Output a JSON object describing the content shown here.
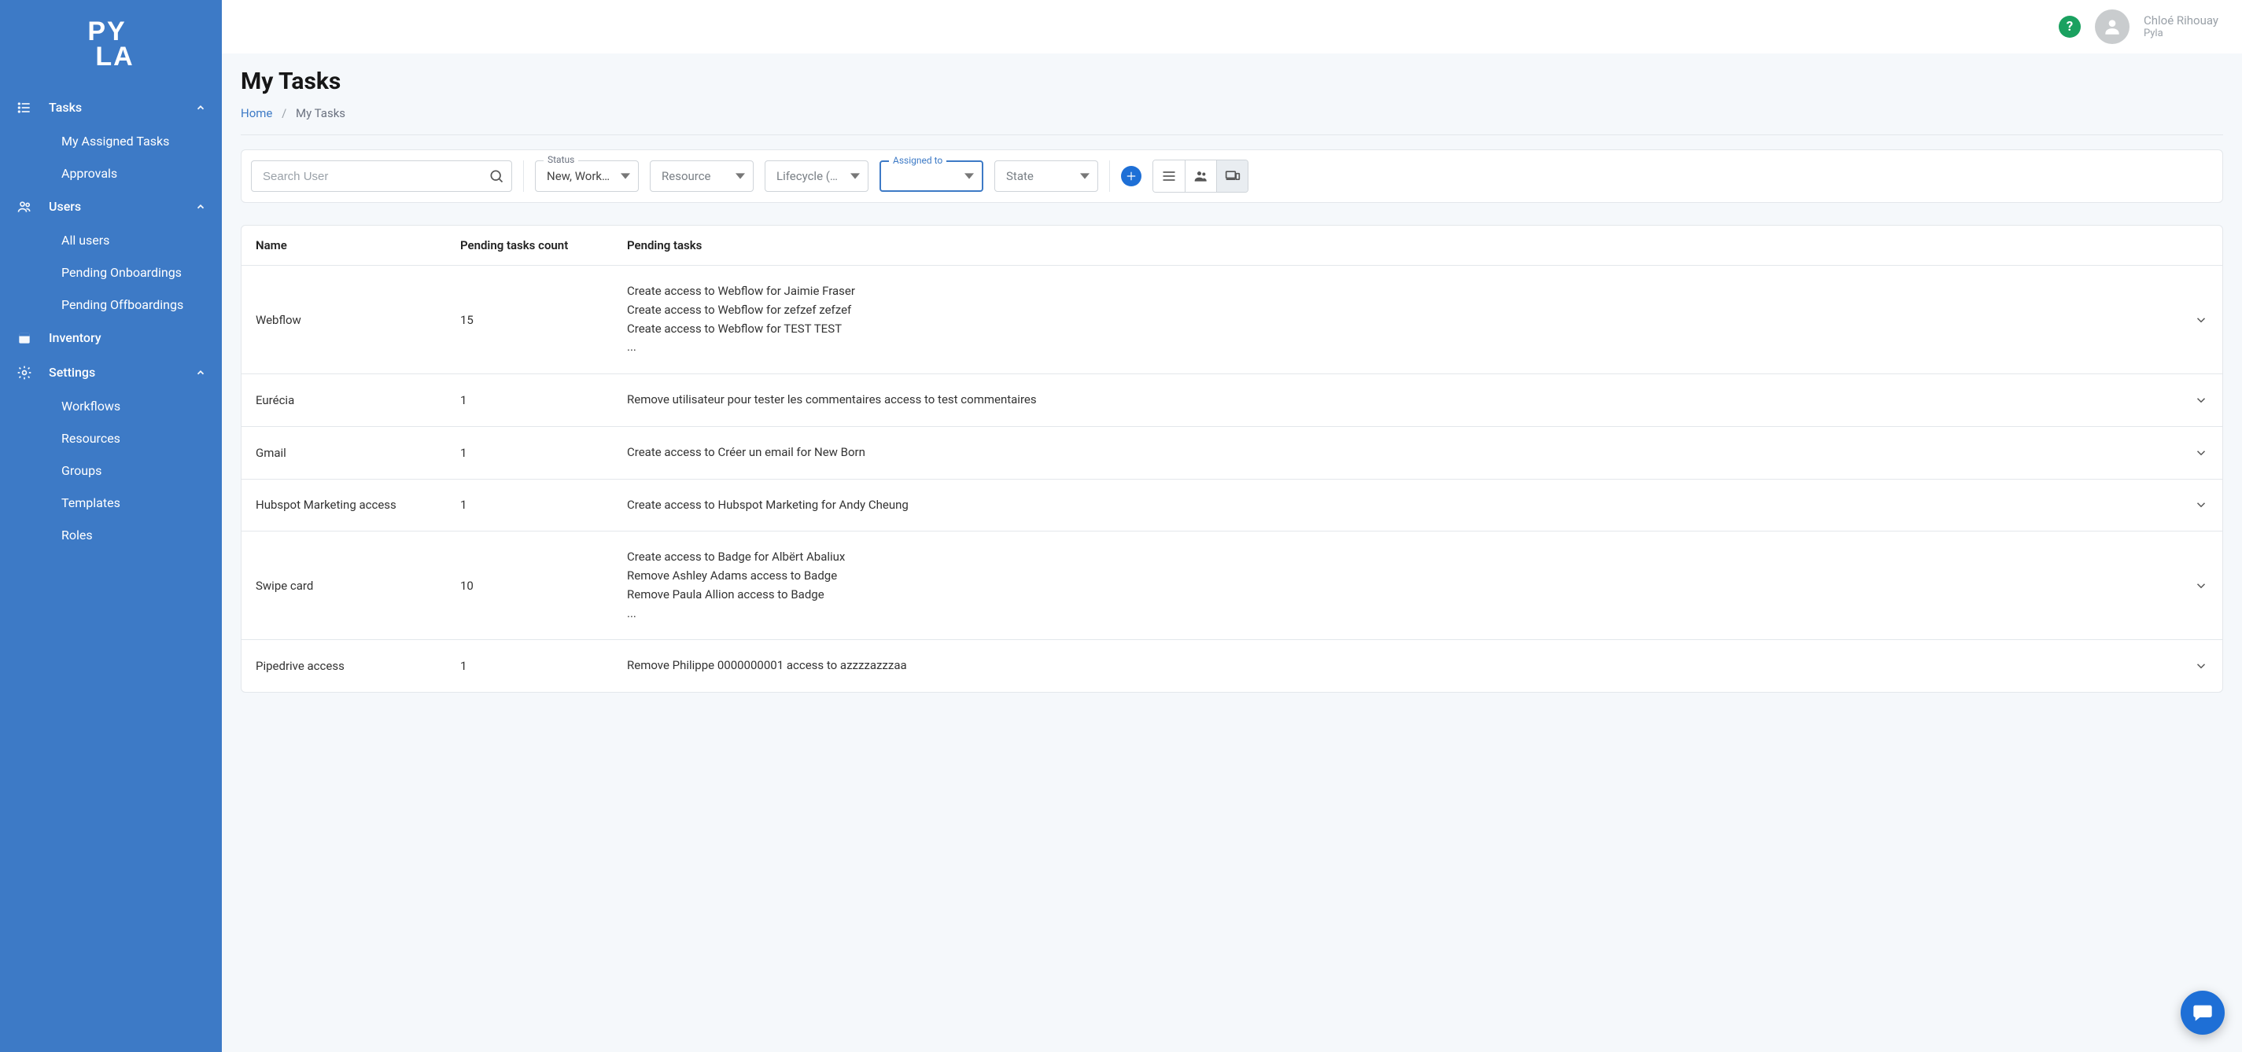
{
  "brand": "PYLA",
  "user": {
    "name": "Chloé Rihouay",
    "org": "Pyla"
  },
  "sidebar": {
    "items": [
      {
        "label": "Tasks",
        "icon": "list",
        "expandable": true
      },
      {
        "label": "My Assigned Tasks",
        "sub": true
      },
      {
        "label": "Approvals",
        "sub": true
      },
      {
        "label": "Users",
        "icon": "users",
        "expandable": true
      },
      {
        "label": "All users",
        "sub": true
      },
      {
        "label": "Pending Onboardings",
        "sub": true
      },
      {
        "label": "Pending Offboardings",
        "sub": true
      },
      {
        "label": "Inventory",
        "icon": "box"
      },
      {
        "label": "Settings",
        "icon": "gear",
        "expandable": true
      },
      {
        "label": "Workflows",
        "sub": true
      },
      {
        "label": "Resources",
        "sub": true
      },
      {
        "label": "Groups",
        "sub": true
      },
      {
        "label": "Templates",
        "sub": true
      },
      {
        "label": "Roles",
        "sub": true
      }
    ]
  },
  "page": {
    "title": "My Tasks",
    "breadcrumb": {
      "home": "Home",
      "current": "My Tasks"
    }
  },
  "filters": {
    "search_placeholder": "Search User",
    "status": {
      "label": "Status",
      "value": "New, Workon"
    },
    "resource": {
      "label": "Resource",
      "value": "Resource"
    },
    "lifecycle": {
      "label": "Lifecycle",
      "value": "Lifecycle (on..."
    },
    "assigned_to": {
      "label": "Assigned to",
      "value": ""
    },
    "state": {
      "label": "State",
      "value": "State"
    }
  },
  "table": {
    "columns": {
      "name": "Name",
      "count": "Pending tasks count",
      "tasks": "Pending tasks"
    },
    "rows": [
      {
        "name": "Webflow",
        "count": "15",
        "tasks": [
          "Create access to Webflow for Jaimie Fraser",
          "Create access to Webflow for zefzef zefzef",
          "Create access to Webflow for TEST TEST",
          "..."
        ]
      },
      {
        "name": "Eurécia",
        "count": "1",
        "tasks": [
          "Remove utilisateur pour tester les commentaires access to test commentaires"
        ]
      },
      {
        "name": "Gmail",
        "count": "1",
        "tasks": [
          "Create access to Créer un email for New Born"
        ]
      },
      {
        "name": "Hubspot Marketing access",
        "count": "1",
        "tasks": [
          "Create access to Hubspot Marketing for Andy Cheung"
        ]
      },
      {
        "name": "Swipe card",
        "count": "10",
        "tasks": [
          "Create access to Badge for Albërt Abaliux",
          "Remove Ashley Adams access to Badge",
          "Remove Paula Allion access to Badge",
          "..."
        ]
      },
      {
        "name": "Pipedrive access",
        "count": "1",
        "tasks": [
          "Remove Philippe 0000000001 access to azzzzazzzaa"
        ]
      }
    ]
  }
}
